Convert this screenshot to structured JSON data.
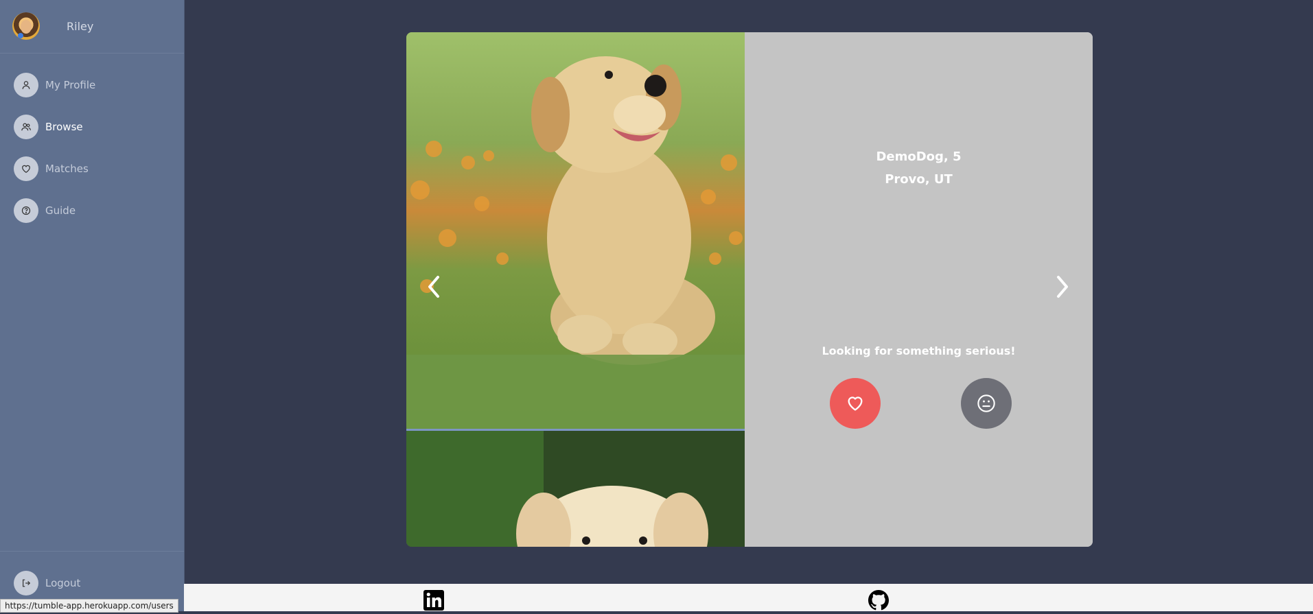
{
  "sidebar": {
    "username": "Riley",
    "items": [
      {
        "label": "My Profile",
        "icon": "user-icon"
      },
      {
        "label": "Browse",
        "icon": "users-icon",
        "active": true
      },
      {
        "label": "Matches",
        "icon": "heart-icon"
      },
      {
        "label": "Guide",
        "icon": "help-icon"
      }
    ],
    "logout_label": "Logout"
  },
  "status_bar": {
    "url": "https://tumble-app.herokuapp.com/users"
  },
  "profile": {
    "name_age": "DemoDog, 5",
    "location": "Provo, UT",
    "tagline": "Looking for something serious!"
  },
  "actions": {
    "like_icon": "heart-icon",
    "pass_icon": "neutral-face-icon"
  },
  "footer": {
    "links": [
      {
        "icon": "linkedin-icon"
      },
      {
        "icon": "github-icon"
      }
    ]
  },
  "colors": {
    "background": "#343a4f",
    "sidebar": "#5f708f",
    "card_info": "#c4c4c4",
    "like": "#ee5a59",
    "pass": "#6e6f77"
  }
}
